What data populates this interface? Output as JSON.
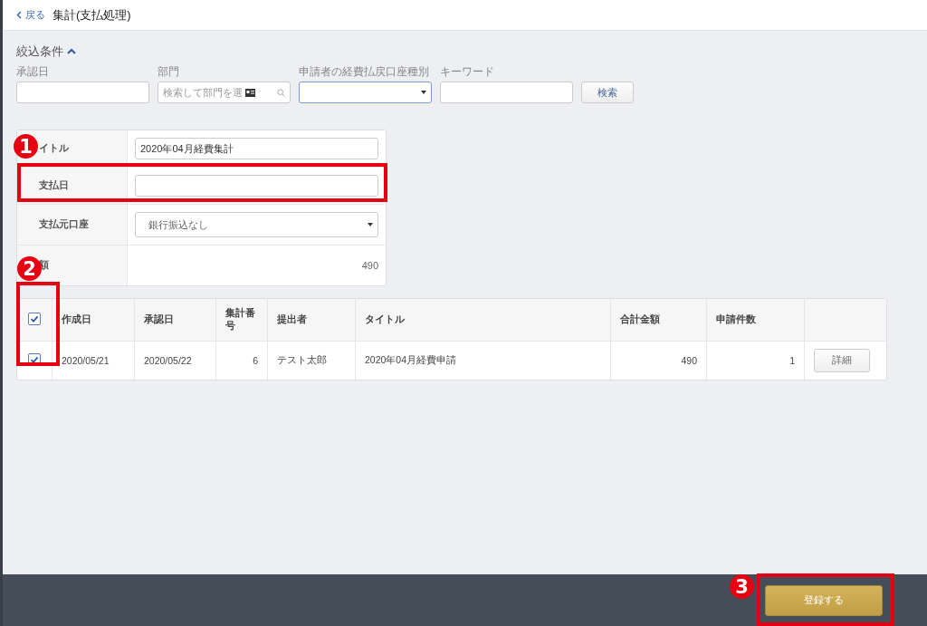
{
  "header": {
    "back": "戻る",
    "title": "集計(支払処理)"
  },
  "filter": {
    "heading": "絞込条件",
    "expanded": true,
    "fields": [
      {
        "kind": "text",
        "label": "承認日"
      },
      {
        "kind": "search",
        "label": "部門",
        "placeholder": "検索して部門を選"
      },
      {
        "kind": "select",
        "label": "申請者の経費払戻口座種別"
      },
      {
        "kind": "text",
        "label": "キーワード"
      }
    ],
    "button": "検索"
  },
  "form": [
    {
      "kind": "input",
      "label": "イトル",
      "value": "2020年04月経費集計"
    },
    {
      "kind": "input",
      "label": "支払日"
    },
    {
      "kind": "select",
      "label": "支払元口座",
      "value": "銀行振込なし"
    },
    {
      "kind": "static",
      "label": "額",
      "value": "490"
    }
  ],
  "table": {
    "all_checked": true,
    "columns": [
      {
        "label": "作成日",
        "numeric": false
      },
      {
        "label": "承認日",
        "numeric": false
      },
      {
        "label": "集計番号",
        "numeric": true
      },
      {
        "label": "提出者",
        "numeric": false
      },
      {
        "label": "タイトル",
        "numeric": false
      },
      {
        "label": "合計金額",
        "numeric": true
      },
      {
        "label": "申請件数",
        "numeric": true
      }
    ],
    "rows": [
      {
        "checked": true,
        "cells": [
          "2020/05/21",
          "2020/05/22",
          "6",
          "テスト太郎",
          "2020年04月経費申請",
          "490",
          "1"
        ],
        "action": "詳細"
      }
    ]
  },
  "footer": {
    "button": "登録する"
  },
  "annotations": [
    {
      "number": "1"
    },
    {
      "number": "2"
    },
    {
      "number": "3"
    }
  ]
}
